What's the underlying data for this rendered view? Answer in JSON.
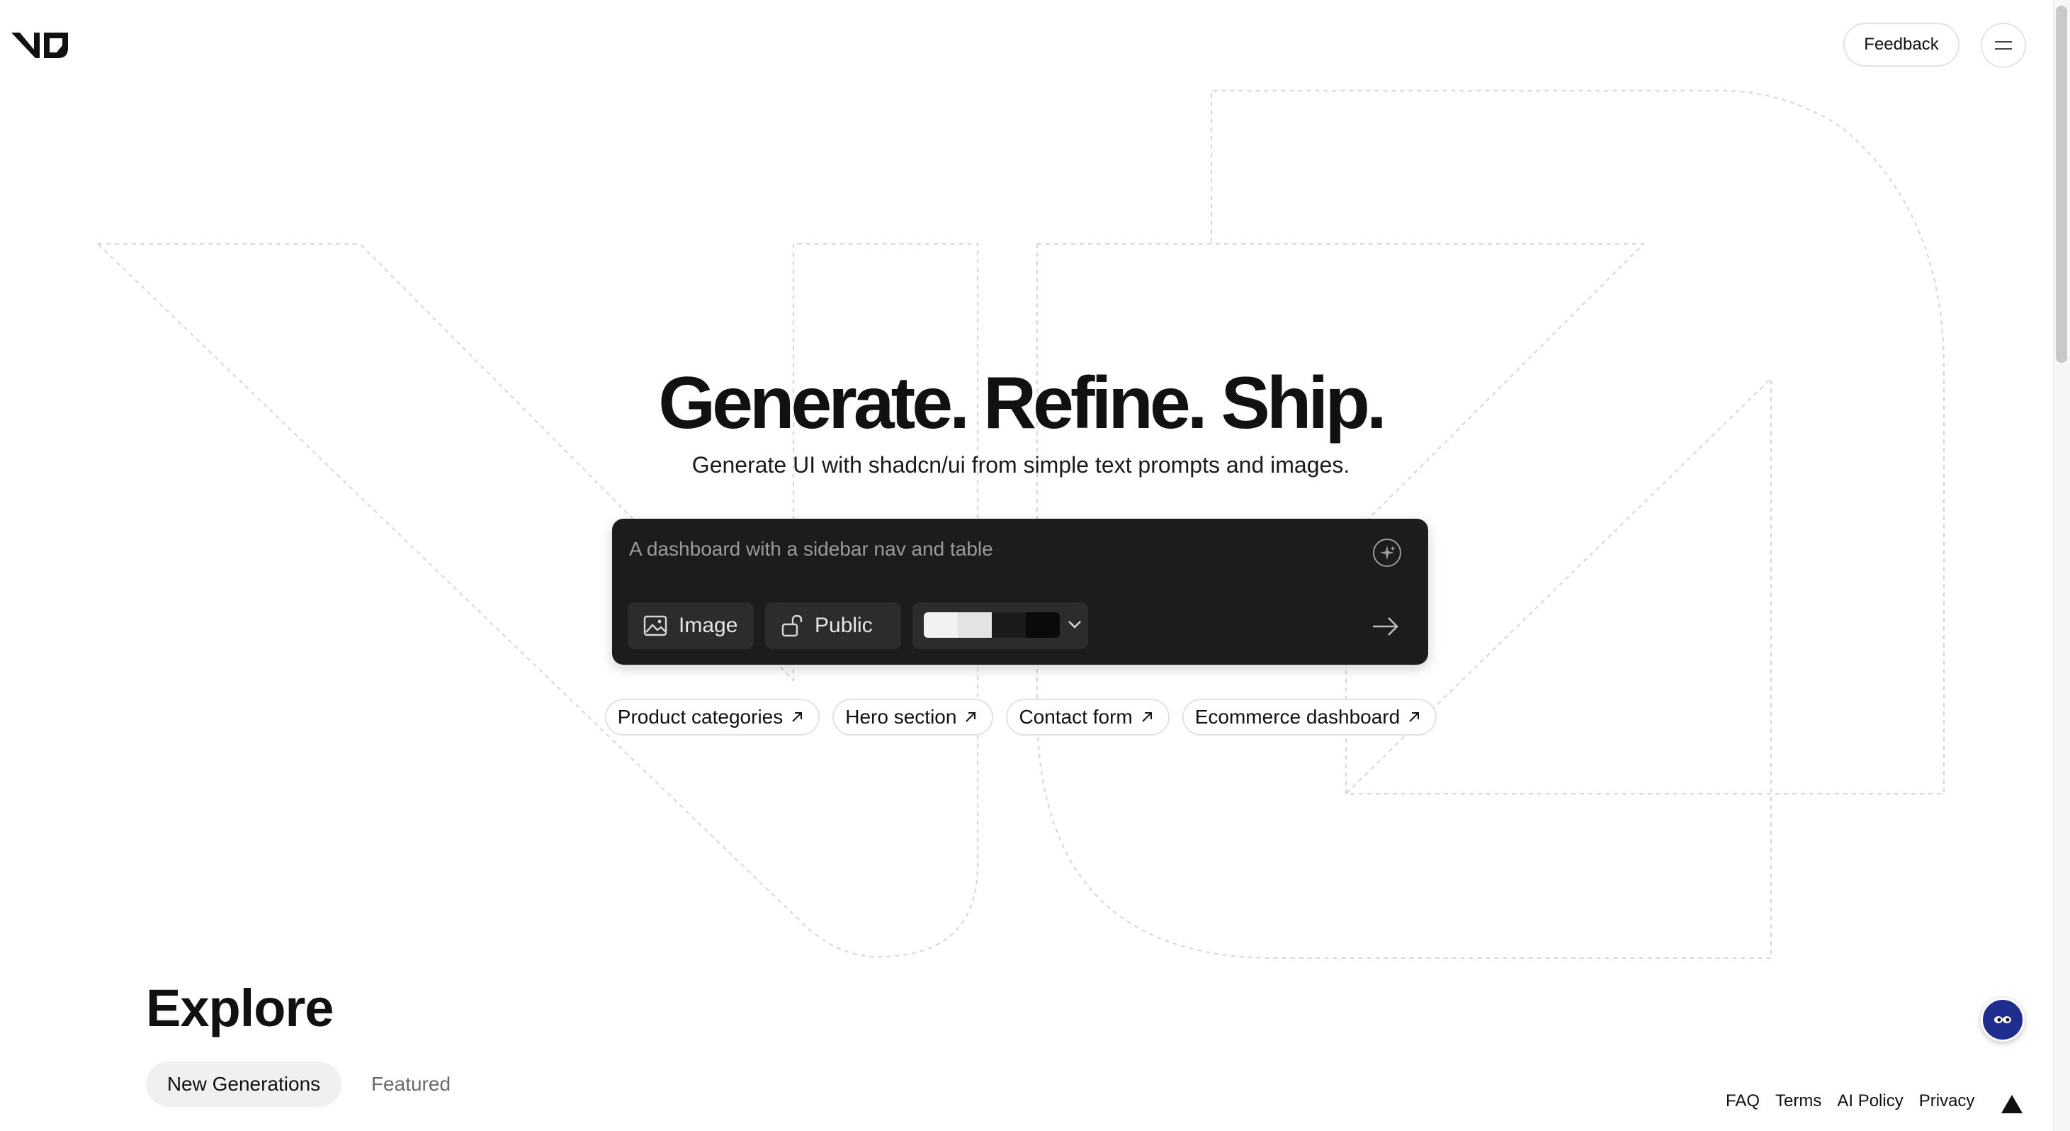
{
  "header": {
    "feedback_label": "Feedback"
  },
  "hero": {
    "title": "Generate. Refine. Ship.",
    "subtitle": "Generate UI with shadcn/ui from simple text prompts and images."
  },
  "prompt": {
    "placeholder": "A dashboard with a sidebar nav and table",
    "image_label": "Image",
    "visibility_label": "Public",
    "theme_swatches": [
      "#f2f2f2",
      "#e3e3e3",
      "#1b1b1b",
      "#0a0a0a"
    ]
  },
  "suggestions": [
    {
      "label": "Product categories"
    },
    {
      "label": "Hero section"
    },
    {
      "label": "Contact form"
    },
    {
      "label": "Ecommerce dashboard"
    }
  ],
  "explore": {
    "title": "Explore",
    "tabs": [
      {
        "label": "New Generations",
        "active": true
      },
      {
        "label": "Featured",
        "active": false
      }
    ]
  },
  "footer": {
    "links": [
      "FAQ",
      "Terms",
      "AI Policy",
      "Privacy"
    ]
  },
  "icons": {
    "logo": "v0-logo",
    "menu": "menu-icon",
    "enhance": "sparkle-icon",
    "image": "image-icon",
    "visibility": "unlock-icon",
    "dropdown": "chevron-down-icon",
    "submit": "arrow-right-icon",
    "chip_arrow": "arrow-up-right-icon",
    "vercel": "triangle-icon"
  },
  "colors": {
    "prompt_bg": "#1c1c1e",
    "prompt_button_bg": "#2c2c2e",
    "chat_fab": "#1f2d8f"
  }
}
